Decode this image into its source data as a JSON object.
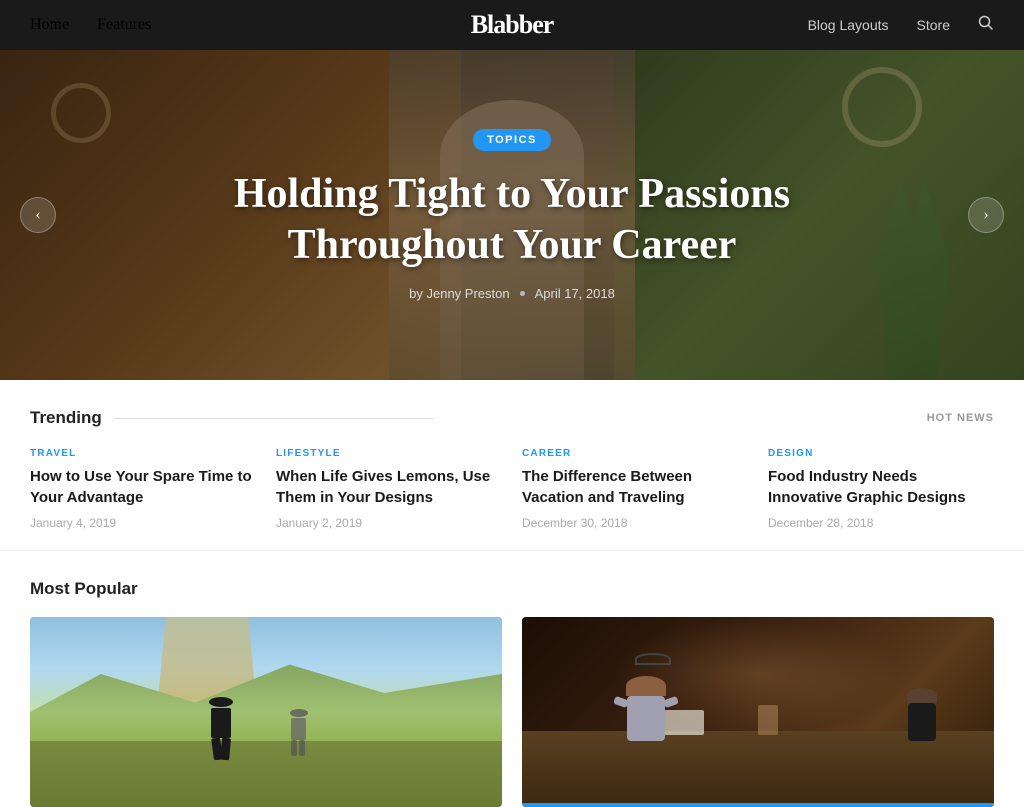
{
  "nav": {
    "links": [
      "Home",
      "Features",
      "Blog Layouts",
      "Store"
    ],
    "logo": "Blabber",
    "search_icon": "🔍"
  },
  "hero": {
    "badge": "TOPICS",
    "title_line1": "Holding Tight to Your Passions",
    "title_line2": "Throughout Your Career",
    "author": "by Jenny Preston",
    "date": "April 17, 2018",
    "prev_arrow": "‹",
    "next_arrow": "›"
  },
  "trending": {
    "section_title": "Trending",
    "hot_news_label": "HOT NEWS",
    "cards": [
      {
        "category": "TRAVEL",
        "title": "How to Use Your Spare Time to Your Advantage",
        "date": "January 4, 2019"
      },
      {
        "category": "LIFESTYLE",
        "title": "When Life Gives Lemons, Use Them in Your Designs",
        "date": "January 2, 2019"
      },
      {
        "category": "CAREER",
        "title": "The Difference Between Vacation and Traveling",
        "date": "December 30, 2018"
      },
      {
        "category": "DESIGN",
        "title": "Food Industry Needs Innovative Graphic Designs",
        "date": "December 28, 2018"
      }
    ]
  },
  "popular": {
    "section_title": "Most Popular"
  }
}
